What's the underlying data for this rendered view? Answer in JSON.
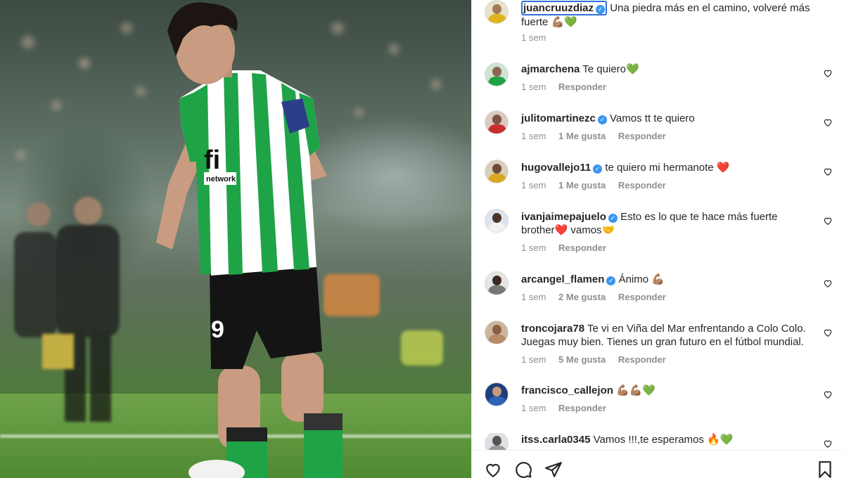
{
  "post": {
    "owner": "juancruuzdiaz",
    "caption": "Una piedra más en el camino, volveré más fuerte 💪🏽💚",
    "time": "1 sem"
  },
  "comments": [
    {
      "user": "ajmarchena",
      "verified": false,
      "text": "Te quiero💚",
      "time": "1 sem",
      "likes": "",
      "reply": "Responder"
    },
    {
      "user": "julitomartinezc",
      "verified": true,
      "text": "Vamos tt te quiero",
      "time": "1 sem",
      "likes": "1 Me gusta",
      "reply": "Responder"
    },
    {
      "user": "hugovallejo11",
      "verified": true,
      "text": "te quiero mi hermanote ❤️",
      "time": "1 sem",
      "likes": "1 Me gusta",
      "reply": "Responder"
    },
    {
      "user": "ivanjaimepajuelo",
      "verified": true,
      "text": "Esto es lo que te hace más fuerte brother❤️ vamos🤝",
      "time": "1 sem",
      "likes": "",
      "reply": "Responder"
    },
    {
      "user": "arcangel_flamen",
      "verified": true,
      "text": "Ánimo 💪🏽",
      "time": "1 sem",
      "likes": "2 Me gusta",
      "reply": "Responder"
    },
    {
      "user": "troncojara78",
      "verified": false,
      "text": "Te vi en Viña del Mar enfrentando a Colo Colo. Juegas muy bien. Tienes un gran futuro en el fútbol mundial.",
      "time": "1 sem",
      "likes": "5 Me gusta",
      "reply": "Responder"
    },
    {
      "user": "francisco_callejon",
      "verified": false,
      "text": "💪🏽💪🏽💚",
      "time": "1 sem",
      "likes": "",
      "reply": "Responder"
    },
    {
      "user": "itss.carla0345",
      "verified": false,
      "text": "Vamos !!!,te esperamos 🔥💚",
      "time": "",
      "likes": "",
      "reply": ""
    }
  ],
  "icons": {
    "like": "heart-icon",
    "comment": "comment-icon",
    "share": "paper-plane-icon",
    "save": "bookmark-icon"
  },
  "colors": {
    "verified": "#3897f0",
    "highlight_border": "#2f6fd6",
    "jersey_green": "#1fa347"
  }
}
